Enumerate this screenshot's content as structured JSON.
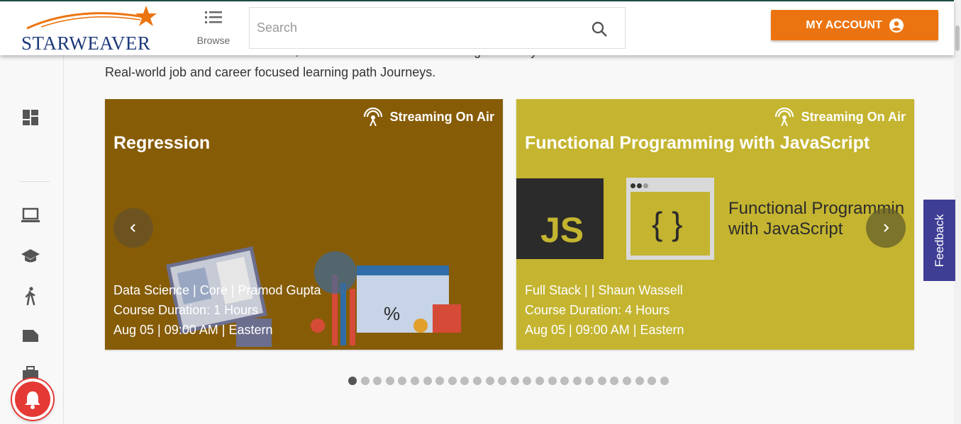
{
  "header": {
    "logo_text": "STARWEAVER",
    "browse_label": "Browse",
    "search_placeholder": "Search",
    "account_label": "MY ACCOUNT"
  },
  "intro": {
    "line1": "Hundreds of hours of live courses, live hands-on labs and challenges weekly",
    "line2": "Real-world job and career focused learning path Journeys."
  },
  "cards": [
    {
      "badge": "Streaming On Air",
      "title": "Regression",
      "meta1": "Data Science | Core | Pramod Gupta",
      "meta2": "Course Duration: 1 Hours",
      "meta3": "Aug 05 | 09:00 AM | Eastern",
      "bg_color": "#875c07"
    },
    {
      "badge": "Streaming On Air",
      "title": "Functional Programming with JavaScript",
      "meta1": "Full Stack | | Shaun Wassell",
      "meta2": "Course Duration: 4 Hours",
      "meta3": "Aug 05 | 09:00 AM | Eastern",
      "bg_color": "#c4b430",
      "image_js_text": "JS",
      "image_braces": "{ }",
      "image_line1": "Functional Programmin",
      "image_line2": "with JavaScript"
    }
  ],
  "carousel": {
    "total_dots": 26,
    "active_index": 0
  },
  "feedback_label": "Feedback",
  "colors": {
    "accent": "#ec7410",
    "feedback": "#3f3e95",
    "notification": "#e53935",
    "logo": "#1d3a7a"
  },
  "icons": [
    "menu-icon",
    "search-icon",
    "account-circle-icon",
    "dashboard-icon",
    "laptop-icon",
    "school-icon",
    "walk-icon",
    "label-icon",
    "video-library-icon",
    "broadcast-icon",
    "chevron-left-icon",
    "chevron-right-icon",
    "bell-icon"
  ]
}
